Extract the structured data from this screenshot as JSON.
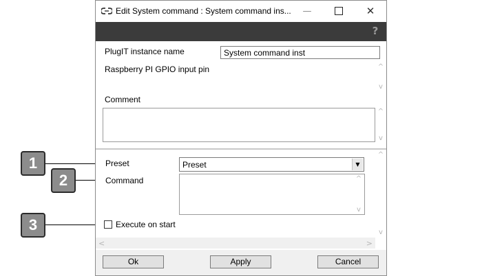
{
  "window": {
    "title": "Edit System command : System command ins...",
    "minimize_glyph": "—",
    "close_glyph": "✕"
  },
  "toolbar": {
    "help_glyph": "?"
  },
  "form": {
    "instance_name_label": "PlugIT instance name",
    "instance_name_value": "System command inst",
    "gpio_label": "Raspberry PI GPIO input pin",
    "comment_label": "Comment",
    "preset_label": "Preset",
    "preset_value": "Preset",
    "command_label": "Command",
    "execute_on_start_label": "Execute on start",
    "execute_on_start_checked": false
  },
  "scroll_glyphs": {
    "up": "^",
    "down": "v",
    "select": "▼",
    "left": "<",
    "right": ">"
  },
  "buttons": {
    "ok": "Ok",
    "apply": "Apply",
    "cancel": "Cancel"
  },
  "callouts": [
    "1",
    "2",
    "3"
  ],
  "icons": {
    "app": "link-icon",
    "help": "question-mark-icon",
    "minimize": "minimize-icon",
    "maximize": "maximize-icon",
    "close": "close-icon"
  }
}
